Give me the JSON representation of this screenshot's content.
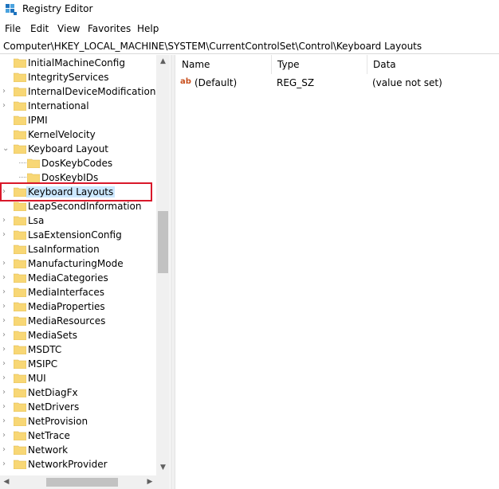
{
  "window": {
    "title": "Registry Editor"
  },
  "menu": [
    "File",
    "Edit",
    "View",
    "Favorites",
    "Help"
  ],
  "address": "Computer\\HKEY_LOCAL_MACHINE\\SYSTEM\\CurrentControlSet\\Control\\Keyboard Layouts",
  "tree": {
    "items": [
      {
        "label": "InitialMachineConfig",
        "chevron": ""
      },
      {
        "label": "IntegrityServices",
        "chevron": ""
      },
      {
        "label": "InternalDeviceModification",
        "chevron": "›"
      },
      {
        "label": "International",
        "chevron": "›"
      },
      {
        "label": "IPMI",
        "chevron": ""
      },
      {
        "label": "KernelVelocity",
        "chevron": ""
      },
      {
        "label": "Keyboard Layout",
        "chevron": "⌄"
      },
      {
        "label": "DosKeybCodes",
        "chevron": ""
      },
      {
        "label": "DosKeybIDs",
        "chevron": ""
      },
      {
        "label": "Keyboard Layouts",
        "chevron": "›"
      },
      {
        "label": "LeapSecondInformation",
        "chevron": ""
      },
      {
        "label": "Lsa",
        "chevron": "›"
      },
      {
        "label": "LsaExtensionConfig",
        "chevron": "›"
      },
      {
        "label": "LsaInformation",
        "chevron": ""
      },
      {
        "label": "ManufacturingMode",
        "chevron": "›"
      },
      {
        "label": "MediaCategories",
        "chevron": "›"
      },
      {
        "label": "MediaInterfaces",
        "chevron": "›"
      },
      {
        "label": "MediaProperties",
        "chevron": "›"
      },
      {
        "label": "MediaResources",
        "chevron": "›"
      },
      {
        "label": "MediaSets",
        "chevron": "›"
      },
      {
        "label": "MSDTC",
        "chevron": "›"
      },
      {
        "label": "MSIPC",
        "chevron": "›"
      },
      {
        "label": "MUI",
        "chevron": "›"
      },
      {
        "label": "NetDiagFx",
        "chevron": "›"
      },
      {
        "label": "NetDrivers",
        "chevron": "›"
      },
      {
        "label": "NetProvision",
        "chevron": "›"
      },
      {
        "label": "NetTrace",
        "chevron": "›"
      },
      {
        "label": "Network",
        "chevron": "›"
      },
      {
        "label": "NetworkProvider",
        "chevron": "›"
      }
    ]
  },
  "list": {
    "columns": [
      "Name",
      "Type",
      "Data"
    ],
    "rows": [
      {
        "icon": "ab",
        "name": "(Default)",
        "type": "REG_SZ",
        "data": "(value not set)"
      }
    ]
  },
  "colors": {
    "selection": "#cce8ff",
    "highlight_border": "#d9182a",
    "folder": "#f8d775"
  },
  "icons": {
    "app": "registry-editor-icon",
    "folder": "folder-icon",
    "string_value": "reg-sz-icon"
  }
}
